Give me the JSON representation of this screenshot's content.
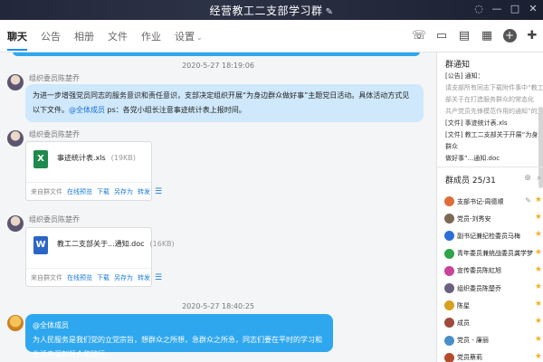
{
  "window": {
    "title": "经营教工二支部学习群",
    "edit_icon": "pencil-icon",
    "controls": [
      "mute-icon",
      "minimize-icon",
      "maximize-icon",
      "close-icon"
    ]
  },
  "tabs": [
    {
      "label": "聊天",
      "active": true
    },
    {
      "label": "公告"
    },
    {
      "label": "相册"
    },
    {
      "label": "文件"
    },
    {
      "label": "作业"
    },
    {
      "label": "设置"
    }
  ],
  "toolbar_icons": [
    "phone-icon",
    "video-icon",
    "doc-icon",
    "screen-icon",
    "add-icon",
    "more-icon"
  ],
  "messages": [
    {
      "type": "timestamp",
      "text": "2020-5-27 18:19:06"
    },
    {
      "type": "text",
      "sender": "组织委员陈楚乔",
      "text": "为进一步增强党员同志的服务意识和责任意识，支部决定组织开展“为身边群众做好事”主题党日活动。具体活动方式见以下文件。",
      "at": "@全体成员",
      "text2": " ps：各党小组长注意事迹统计表上报时间。"
    },
    {
      "type": "file",
      "sender": "组织委员陈楚乔",
      "file_type": "excel",
      "name": "事迹统计表.xls",
      "size": "(19KB)",
      "source": "来自群文件",
      "actions": [
        "在线预览",
        "下载",
        "另存为",
        "转发"
      ]
    },
    {
      "type": "file",
      "sender": "组织委员陈楚乔",
      "file_type": "word",
      "name": "教工二支部关于...通知.doc",
      "size": "(16KB)",
      "source": "来自群文件",
      "actions": [
        "在线预览",
        "下载",
        "另存为",
        "转发"
      ]
    },
    {
      "type": "timestamp",
      "text": "2020-5-27 18:40:25"
    },
    {
      "type": "text",
      "sender": "",
      "at": "@全体成员",
      "text": "为人民服务是我们党的立党宗旨，想群众之所想，急群众之所急，同志们要在平时的学习和生活中深刻领会和践行。"
    }
  ],
  "sidebar": {
    "title": "群通知",
    "notice_lines": [
      "[公告] 通知：",
      "请支部所有同志下载附件事中“教工二支",
      "部关于在打造服务群众的常态化",
      "共产党员先锋模范作用的通知”的文件",
      "[文件] 事迹统计表.xls",
      "[文件] 教工二支部关于开展“为身边群众",
      "做好事”...通知.doc"
    ],
    "members_label": "群成员 25/31",
    "members": [
      {
        "name": "支部书记-周德顺",
        "color": "#e06c3b",
        "edit": true,
        "star": true
      },
      {
        "name": "党员-刘秀安",
        "color": "#7a6a55",
        "star": true
      },
      {
        "name": "副书记兼纪检委员马梅",
        "color": "#2b6fd8",
        "star": true
      },
      {
        "name": "青年委员兼统战委员龚学梦",
        "color": "#2fa34a",
        "star": true
      },
      {
        "name": "宣传委员陈虹旭",
        "color": "#c9439a",
        "star": true
      },
      {
        "name": "组织委员陈楚乔",
        "color": "#6b6080",
        "star": true
      },
      {
        "name": "陈星",
        "color": "#d8a021",
        "star": true
      },
      {
        "name": "成员",
        "color": "#a04a3b",
        "star": true
      },
      {
        "name": "党员 - 廉丽",
        "color": "#4a90c8",
        "star": true
      },
      {
        "name": "党员蔡莉",
        "color": "#b34d2b",
        "star": true
      }
    ]
  }
}
